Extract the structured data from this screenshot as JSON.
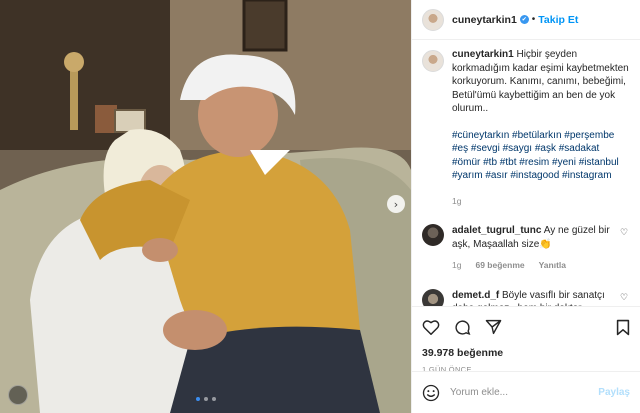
{
  "post": {
    "username": "cuneytarkin1",
    "verified_mark": "✔",
    "separator": "•",
    "follow_label": "Takip Et"
  },
  "caption": {
    "username": "cuneytarkin1",
    "text": "Hiçbir şeyden korkmadığım kadar eşimi kaybetmekten korkuyorum. Kanımı, canımı, bebeğimi, Betül'ümü kaybettiğim an ben de yok olurum..",
    "hashtags": "#cüneytarkın #betülarkın #perşembe #eş #sevgi #saygı #aşk #sadakat #ömür #tb #tbt #resim #yeni #istanbul #yarım #asır #instagood #instagram",
    "time": "1g"
  },
  "comments": [
    {
      "username": "adalet_tugrul_tunc",
      "text": "Ay ne güzel bir aşk, Maşaallah size👏",
      "time": "1g",
      "likes": "69 beğenme",
      "reply": "Yanıtla"
    },
    {
      "username": "demet.d_f",
      "text": "Böyle vasıflı bir sanatçı daha gelmez.. hem bir doktor",
      "time": "",
      "likes": "",
      "reply": ""
    }
  ],
  "actions": {
    "like_icon": "heart-icon",
    "comment_icon": "comment-icon",
    "share_icon": "share-icon",
    "save_icon": "bookmark-icon",
    "likes": "39.978 beğenme",
    "date": "1 GÜN ÖNCE"
  },
  "add_comment": {
    "placeholder": "Yorum ekle...",
    "post_label": "Paylaş"
  },
  "photo": {
    "nav_arrow": "›",
    "dots_total": 3,
    "dots_active": 0
  },
  "colors": {
    "accent": "#0095f6",
    "link": "#00376b",
    "muted": "#8e8e8e",
    "sweater": "#d4a13a"
  }
}
